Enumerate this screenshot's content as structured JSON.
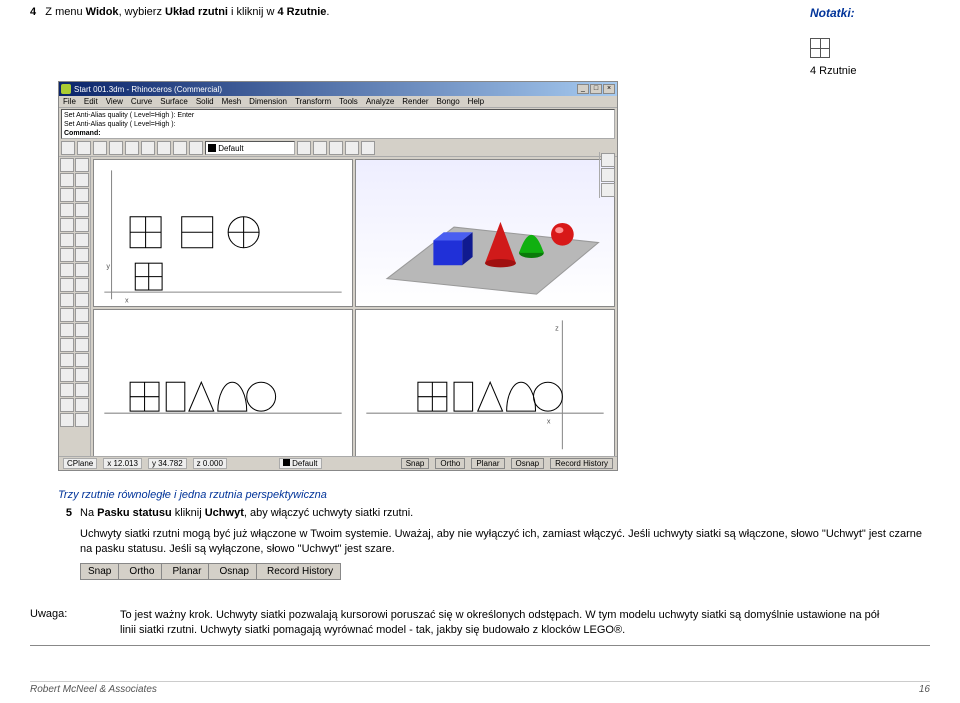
{
  "notes": {
    "title": "Notatki:",
    "sub": "4 Rzutnie"
  },
  "step4": {
    "num": "4",
    "pre": "Z menu ",
    "b1": "Widok",
    "mid": ", wybierz ",
    "b2": "Układ rzutni",
    "mid2": " i kliknij w ",
    "b3": "4 Rzutnie",
    "post": "."
  },
  "app": {
    "title": "Start 001.3dm - Rhinoceros (Commercial)",
    "menu": [
      "File",
      "Edit",
      "View",
      "Curve",
      "Surface",
      "Solid",
      "Mesh",
      "Dimension",
      "Transform",
      "Tools",
      "Analyze",
      "Render",
      "Bongo",
      "Help"
    ],
    "cmd_lines": [
      "Set Anti-Alias quality ( Level=High ): Enter",
      "Set Anti-Alias quality ( Level=High ):"
    ],
    "cmd_prompt": "Command:",
    "layer": "Default",
    "status": {
      "cplane": "CPlane",
      "x": "x 12.013",
      "y": "y 34.782",
      "z": "z 0.000",
      "layer": "Default",
      "btns": [
        "Snap",
        "Ortho",
        "Planar",
        "Osnap",
        "Record History"
      ]
    }
  },
  "desc": {
    "blue": "Trzy rzutnie równoległe i jedna rzutnia perspektywiczna",
    "step5_num": "5",
    "step5_pre": "Na ",
    "step5_b1": "Pasku statusu",
    "step5_mid": " kliknij ",
    "step5_b2": "Uchwyt",
    "step5_post": ", aby włączyć uchwyty siatki rzutni.",
    "p1": "Uchwyty siatki rzutni mogą być już włączone w Twoim systemie. Uważaj, aby nie wyłączyć ich, zamiast włączyć. Jeśli uchwyty siatki są włączone, słowo \"Uchwyt\" jest czarne na pasku statusu. Jeśli są wyłączone, słowo \"Uchwyt\" jest szare.",
    "snap_btns": [
      "Snap",
      "Ortho",
      "Planar",
      "Osnap",
      "Record History"
    ]
  },
  "uwaga": {
    "label": "Uwaga:",
    "text": "To jest ważny krok. Uchwyty siatki pozwalają kursorowi poruszać się w określonych odstępach. W tym modelu uchwyty siatki są domyślnie ustawione na pół linii siatki rzutni. Uchwyty siatki pomagają wyrównać model - tak, jakby się budowało z klocków LEGO®."
  },
  "footer": {
    "left": "Robert McNeel & Associates",
    "right": "16"
  }
}
